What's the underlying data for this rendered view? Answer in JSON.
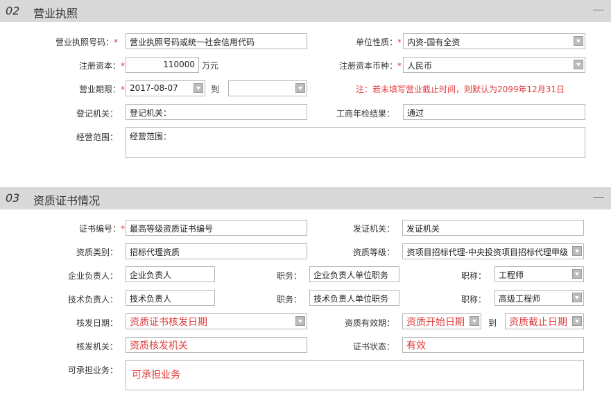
{
  "section2": {
    "num": "02",
    "title": "营业执照",
    "license_no_label": "营业执照号码：",
    "license_no_value": "营业执照号码或统一社会信用代码",
    "unit_type_label": "单位性质：",
    "unit_type_value": "内资-国有全资",
    "capital_label": "注册资本：",
    "capital_value": "110000",
    "capital_unit": "万元",
    "currency_label": "注册资本币种：",
    "currency_value": "人民币",
    "term_label": "营业期限：",
    "term_start": "2017-08-07",
    "to": "到",
    "term_end": "",
    "note": "注：若未填写营业截止时间，则默认为2099年12月31日",
    "authority_label": "登记机关：",
    "authority_value": "登记机关：",
    "annual_label": "工商年检结果：",
    "annual_value": "通过",
    "scope_label": "经营范围：",
    "scope_value": "经营范围："
  },
  "section3": {
    "num": "03",
    "title": "资质证书情况",
    "cert_no_label": "证书编号：",
    "cert_no_value": "最高等级资质证书编号",
    "issuer_label": "发证机关：",
    "issuer_value": "发证机关",
    "qual_type_label": "资质类别：",
    "qual_type_value": "招标代理资质",
    "qual_level_label": "资质等级：",
    "qual_level_value": "央投资项目招标代理-中央投资项目招标代理甲级",
    "ent_head_label": "企业负责人：",
    "ent_head_value": "企业负责人",
    "ent_post_label": "职务：",
    "ent_post_value": "企业负责人单位职务",
    "ent_title_label": "职称：",
    "ent_title_value": "工程师",
    "tech_head_label": "技术负责人：",
    "tech_head_value": "技术负责人",
    "tech_post_label": "职务：",
    "tech_post_value": "技术负责人单位职务",
    "tech_title_label": "职称：",
    "tech_title_value": "高级工程师",
    "issue_date_label": "核发日期：",
    "issue_date_value": "资质证书核发日期",
    "validity_label": "资质有效期：",
    "validity_start": "资质开始日期",
    "to": "到",
    "validity_end": "资质截止日期",
    "issue_org_label": "核发机关：",
    "issue_org_value": "资质核发机关",
    "cert_status_label": "证书状态：",
    "cert_status_value": "有效",
    "business_label": "可承担业务：",
    "business_value": "可承担业务"
  },
  "required_mark": "*",
  "colors": {
    "header_bg": "#d9d9d9",
    "required": "#e23b3b",
    "note": "#e23b3b",
    "placeholder_red": "#e03a3a"
  }
}
